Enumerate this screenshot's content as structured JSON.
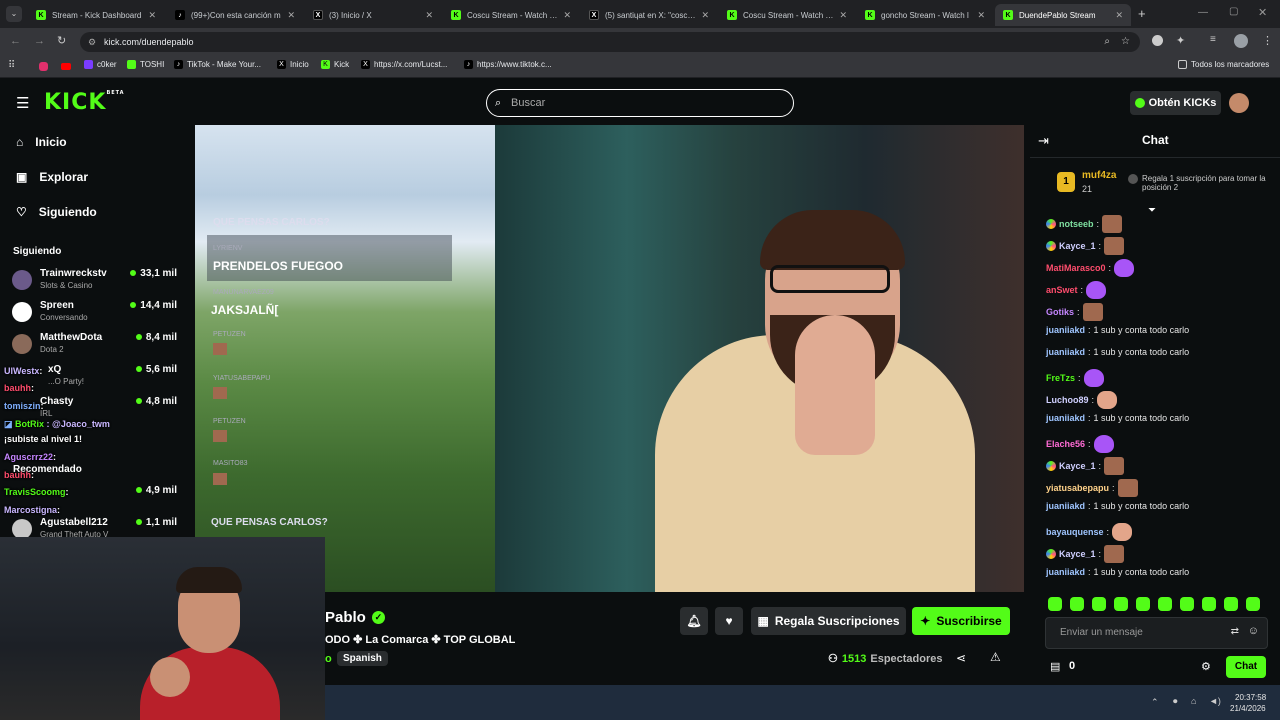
{
  "browser": {
    "tabs": [
      {
        "title": "Stream - Kick Dashboard",
        "icon": "kick"
      },
      {
        "title": "(99+)Con esta canción m",
        "icon": "tiktok"
      },
      {
        "title": "(3) Inicio / X",
        "icon": "x"
      },
      {
        "title": "Coscu Stream - Watch Liv",
        "icon": "kick"
      },
      {
        "title": "(5) santiɥat en X: \"coscu c",
        "icon": "x"
      },
      {
        "title": "Coscu Stream - Watch Liv",
        "icon": "kick"
      },
      {
        "title": "goncho Stream - Watch l",
        "icon": "kick"
      },
      {
        "title": "DuendePablo Stream",
        "icon": "kick",
        "active": true
      }
    ],
    "url": "kick.com/duendepablo",
    "bookmarks": [
      "c0ker",
      "TOSHI",
      "TikTok - Make Your...",
      "Inicio",
      "Kick",
      "https://x.com/Lucst...",
      "https://www.tiktok.c..."
    ],
    "all_bookmarks": "Todos los marcadores"
  },
  "header": {
    "logo": "KICK",
    "logo_beta": "BETA",
    "search_placeholder": "Buscar",
    "kicks_button": "Obtén KICKs"
  },
  "sidebar": {
    "nav": [
      {
        "label": "Inicio",
        "icon": "home-icon"
      },
      {
        "label": "Explorar",
        "icon": "compass-icon"
      },
      {
        "label": "Siguiendo",
        "icon": "heart-icon"
      }
    ],
    "following_title": "Siguiendo",
    "channels": [
      {
        "name": "Trainwreckstv",
        "category": "Slots & Casino",
        "viewers": "33,1 mil"
      },
      {
        "name": "Spreen",
        "category": "Conversando",
        "viewers": "14,4 mil"
      },
      {
        "name": "MatthewDota",
        "category": "Dota 2",
        "viewers": "8,4 mil"
      },
      {
        "name": "xQ",
        "category": "...O Party!",
        "viewers": "5,6 mil"
      },
      {
        "name": "Chasty",
        "category": "IRL",
        "viewers": "4,8 mil"
      }
    ],
    "recommended_title": "Recomendado",
    "recommended": [
      {
        "name": "",
        "category": "",
        "viewers": "4,9 mil"
      },
      {
        "name": "Agustabell212",
        "category": "Grand Theft Auto V",
        "viewers": "1,1 mil"
      }
    ]
  },
  "overlay_chat": [
    {
      "user": "UlWestx",
      "text": ":",
      "color": "#c9b7ff"
    },
    {
      "user": "bauhh",
      "text": ":",
      "color": "#ff4d6d"
    },
    {
      "user": "tomiszin",
      "text": ":",
      "color": "#7fb0ff"
    },
    {
      "user": "BotRix",
      "text": ": @Joaco_twm",
      "color": "#53fc18"
    },
    {
      "user": "",
      "text": "¡subiste al nivel 1!",
      "color": "#ffffff"
    },
    {
      "user": "Aguscrrz22",
      "text": ":",
      "color": "#c586ff"
    },
    {
      "user": "bauhh",
      "text": ":",
      "color": "#ff4d6d"
    },
    {
      "user": "TravisScoomg",
      "text": ":",
      "color": "#53fc18"
    },
    {
      "user": "Marcostigna",
      "text": ":",
      "color": "#c9b7ff"
    }
  ],
  "video": {
    "overlay_question": "QUE PENSAS CARLOS?",
    "overlay_question2": "QUE PENSAS CARLOS?",
    "overlay_messages": [
      {
        "user": "LYRIENV",
        "text": "PRENDELOS FUEGOO"
      },
      {
        "user": "MANUNARVAEZ09",
        "text": "JAKSJALÑ["
      },
      {
        "user": "PETUZEN",
        "text": ""
      },
      {
        "user": "YIATUSABEPAPU",
        "text": ""
      },
      {
        "user": "PETUZEN",
        "text": ""
      },
      {
        "user": "MASITO83",
        "text": ""
      }
    ]
  },
  "stream_info": {
    "channel_name": "Pablo",
    "tags_line": "ODO ✤ La Comarca ✤ TOP GLOBAL",
    "category_prefix": "o",
    "language": "Spanish",
    "viewers": "1513",
    "viewers_label": "Espectadores",
    "gift_button": "Regala Suscripciones",
    "subscribe_button": "Suscribirse"
  },
  "chat": {
    "title": "Chat",
    "top_gifter": {
      "name": "muf4za",
      "count": "21",
      "rank": "1"
    },
    "gift_prompt": "Regala 1 suscripción para tomar la posición 2",
    "messages": [
      {
        "user": "notseeb",
        "color": "#7fe0a0",
        "text": "",
        "badge": true,
        "emote": "face"
      },
      {
        "user": "Kayce_1",
        "color": "#d0d0ff",
        "text": "",
        "badge": true,
        "emote": "face"
      },
      {
        "user": "MatiMarasco0",
        "color": "#ff4d6d",
        "text": "",
        "badge": false,
        "emote": "heart"
      },
      {
        "user": "anSwet",
        "color": "#ff4d6d",
        "text": "",
        "badge": false,
        "emote": "heart"
      },
      {
        "user": "Gotiks",
        "color": "#c586ff",
        "text": "",
        "badge": false,
        "emote": "face"
      },
      {
        "user": "juaniiakd",
        "color": "#9fc5ff",
        "text": "1 sub y conta todo carlo",
        "badge": false,
        "emote": ""
      },
      {
        "user": "juaniiakd",
        "color": "#9fc5ff",
        "text": "1 sub y conta todo carlo",
        "badge": false,
        "emote": ""
      },
      {
        "user": "FreTzs",
        "color": "#53fc18",
        "text": "",
        "badge": false,
        "emote": "heart"
      },
      {
        "user": "Luchoo89",
        "color": "#d0d0ff",
        "text": "",
        "badge": false,
        "emote": "hand"
      },
      {
        "user": "juaniiakd",
        "color": "#9fc5ff",
        "text": "1 sub y conta todo carlo",
        "badge": false,
        "emote": ""
      },
      {
        "user": "Elache56",
        "color": "#ff6bd5",
        "text": "",
        "badge": false,
        "emote": "heart"
      },
      {
        "user": "Kayce_1",
        "color": "#d0d0ff",
        "text": "",
        "badge": true,
        "emote": "face"
      },
      {
        "user": "yiatusabepapu",
        "color": "#ffd28a",
        "text": "",
        "badge": false,
        "emote": "face"
      },
      {
        "user": "juaniiakd",
        "color": "#9fc5ff",
        "text": "1 sub y conta todo carlo",
        "badge": false,
        "emote": ""
      },
      {
        "user": "bayauquense",
        "color": "#9fc5ff",
        "text": "",
        "badge": false,
        "emote": "hand"
      },
      {
        "user": "Kayce_1",
        "color": "#d0d0ff",
        "text": "",
        "badge": true,
        "emote": "face"
      },
      {
        "user": "juaniiakd",
        "color": "#9fc5ff",
        "text": "1 sub y conta todo carlo",
        "badge": false,
        "emote": ""
      }
    ],
    "input_placeholder": "Enviar un mensaje",
    "kicks_count": "0",
    "send_button": "Chat"
  },
  "taskbar": {
    "time": "20:37:58",
    "date": "21/4/2026"
  },
  "colors": {
    "kick_green": "#53fc18",
    "background": "#0b0e0f",
    "browser_bar": "#35363a"
  }
}
